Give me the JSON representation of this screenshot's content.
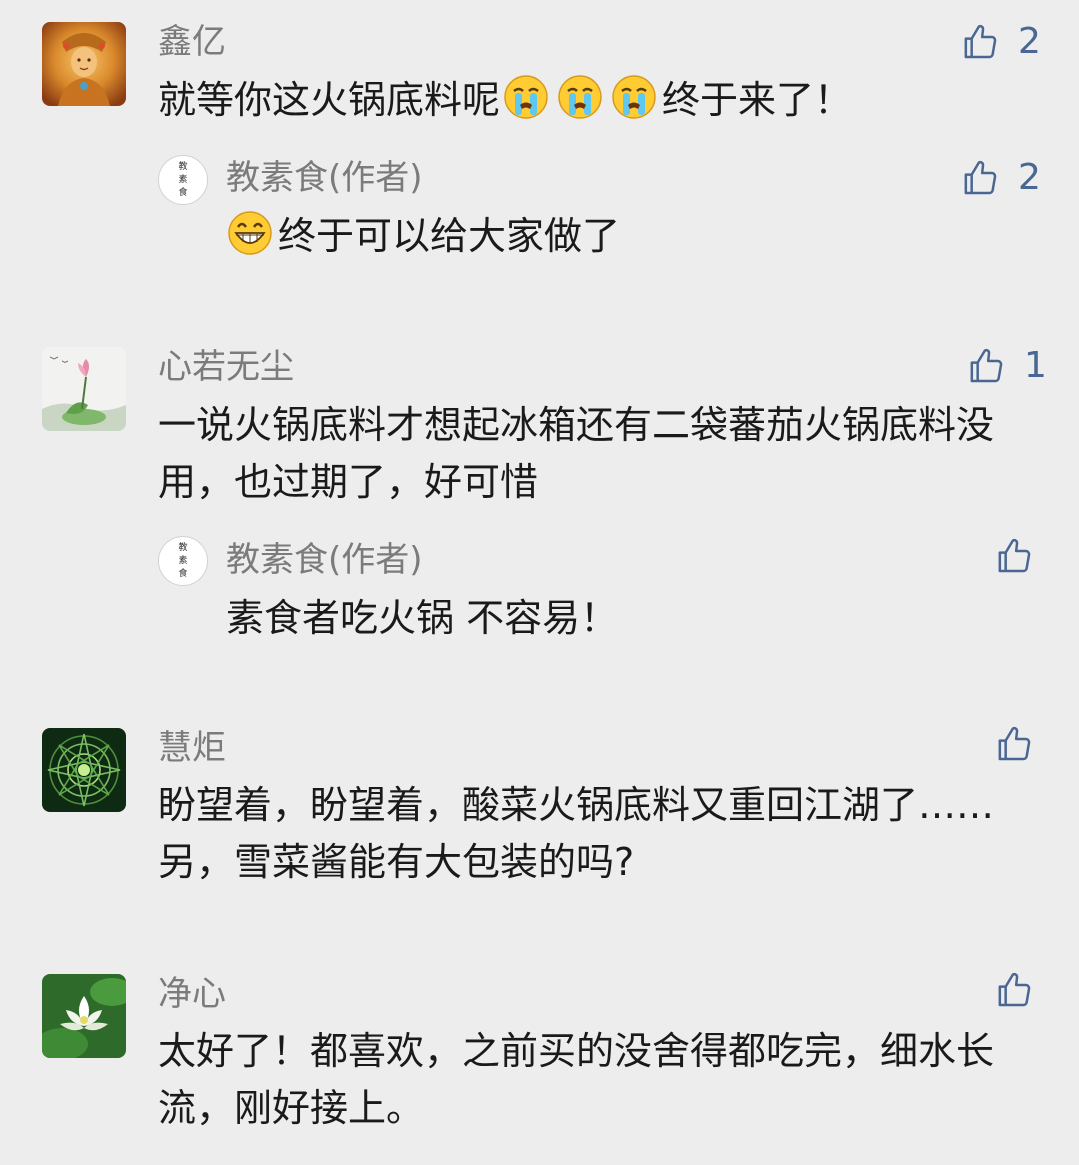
{
  "comments": [
    {
      "name": "鑫亿",
      "text_before": "就等你这火锅底料呢",
      "emojis": [
        "crying-face",
        "crying-face",
        "crying-face"
      ],
      "text_after": "终于来了！",
      "likes": "2",
      "reply": {
        "name": "教素食(作者)",
        "avatar_text": [
          "教",
          "素",
          "食"
        ],
        "emoji": "grinning-face",
        "text": "终于可以给大家做了",
        "likes": "2"
      }
    },
    {
      "name": "心若无尘",
      "text": "一说火锅底料才想起冰箱还有二袋蕃茄火锅底料没用，也过期了，好可惜",
      "likes": "1",
      "reply": {
        "name": "教素食(作者)",
        "avatar_text": [
          "教",
          "素",
          "食"
        ],
        "text": "素食者吃火锅 不容易！",
        "likes": ""
      }
    },
    {
      "name": "慧炬",
      "text": "盼望着，盼望着，酸菜火锅底料又重回江湖了……另，雪菜酱能有大包装的吗?",
      "likes": ""
    },
    {
      "name": "净心",
      "text": "太好了！都喜欢，之前买的没舍得都吃完，细水长流，刚好接上。",
      "likes": ""
    }
  ],
  "colors": {
    "background": "#ededed",
    "name": "#7b7b7b",
    "text": "#1a1a1a",
    "like": "#4a6794"
  },
  "icons": {
    "like": "thumbs-up-outline-icon"
  }
}
